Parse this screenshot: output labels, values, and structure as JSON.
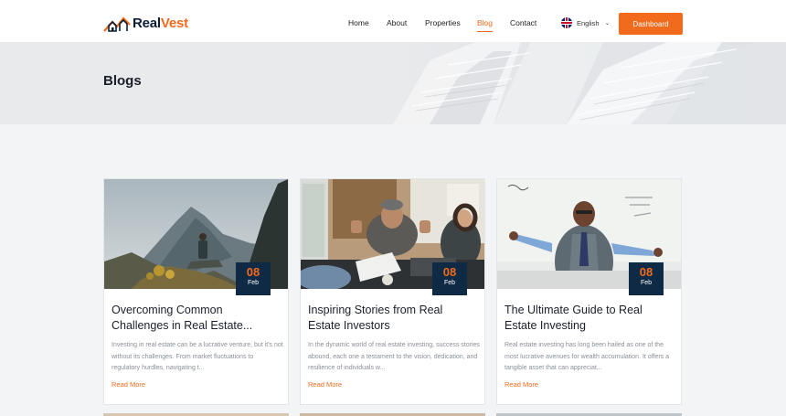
{
  "brand": {
    "name_part1": "Real",
    "name_part2": "Vest"
  },
  "nav": {
    "items": [
      {
        "label": "Home",
        "active": false
      },
      {
        "label": "About",
        "active": false
      },
      {
        "label": "Properties",
        "active": false
      },
      {
        "label": "Blog",
        "active": true
      },
      {
        "label": "Contact",
        "active": false
      }
    ]
  },
  "language": {
    "label": "English"
  },
  "dashboard_button": {
    "label": "Dashboard"
  },
  "hero": {
    "title": "Blogs"
  },
  "posts": [
    {
      "day": "08",
      "month": "Feb",
      "title": "Overcoming Common Challenges in Real Estate...",
      "excerpt": "Investing in real estate can be a lucrative venture, but it's not without its challenges. From market fluctuations to regulatory hurdles, navigating t...",
      "read_more": "Read More",
      "image": "mountain-hiker"
    },
    {
      "day": "08",
      "month": "Feb",
      "title": "Inspiring Stories from Real Estate Investors",
      "excerpt": "In the dynamic world of real estate investing, success stories abound, each one a testament to the vision, dedication, and resilience of individuals w...",
      "read_more": "Read More",
      "image": "office-meeting"
    },
    {
      "day": "08",
      "month": "Feb",
      "title": "The Ultimate Guide to Real Estate Investing",
      "excerpt": "Real estate investing has long been hailed as one of the most lucrative avenues for wealth accumulation. It offers a tangible asset that can appreciat...",
      "read_more": "Read More",
      "image": "presenter-whiteboard"
    }
  ],
  "colors": {
    "accent": "#f26b1d",
    "navy": "#0f2a44",
    "page_bg": "#f3f4f6"
  }
}
